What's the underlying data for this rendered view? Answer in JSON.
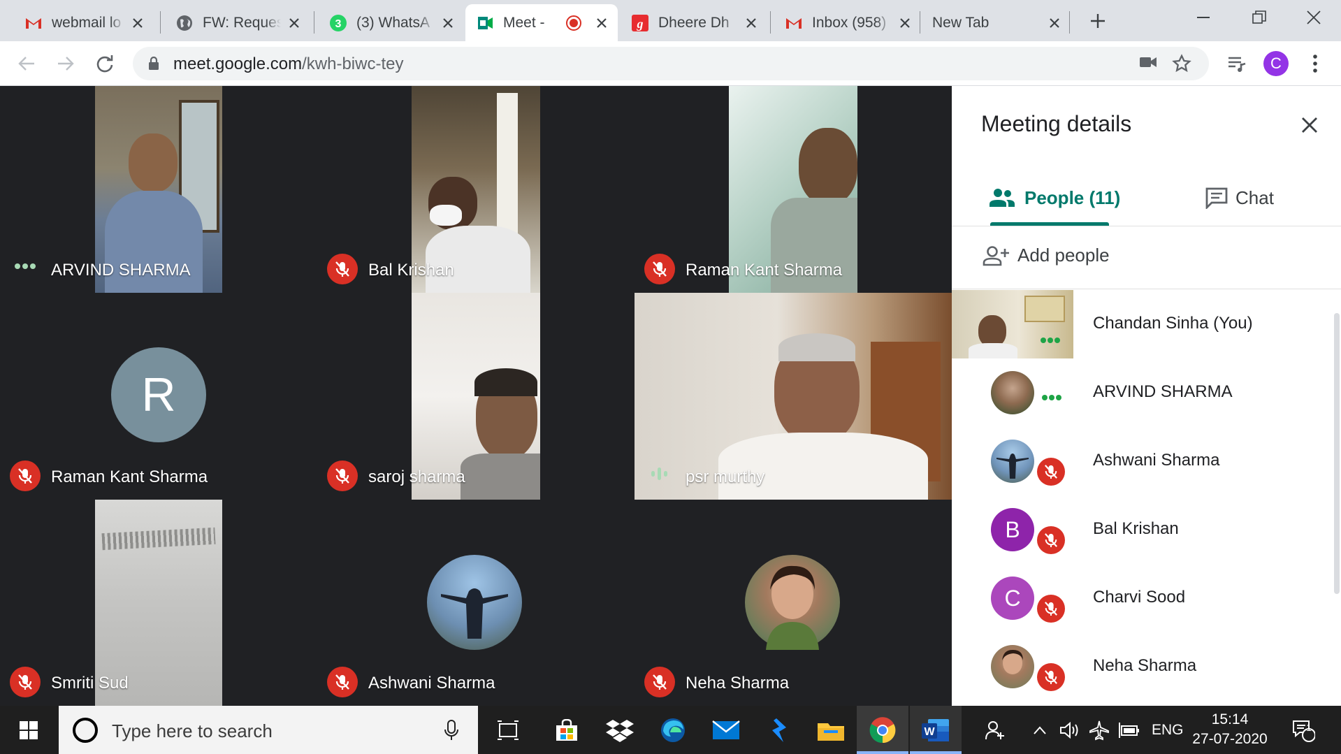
{
  "browser": {
    "tabs": [
      {
        "title": "webmail lo",
        "icon": "gmail-icon",
        "active": false
      },
      {
        "title": "FW: Reques",
        "icon": "globe-icon",
        "active": false
      },
      {
        "title": "(3) WhatsA",
        "icon": "whatsapp-icon",
        "active": false
      },
      {
        "title": "Meet -",
        "icon": "meet-icon",
        "active": true,
        "recording": true
      },
      {
        "title": "Dheere Dh",
        "icon": "gaana-icon",
        "active": false
      },
      {
        "title": "Inbox (958)",
        "icon": "gmail-icon",
        "active": false
      },
      {
        "title": "New Tab",
        "icon": "",
        "active": false
      }
    ],
    "url_host": "meet.google.com",
    "url_path": "/kwh-biwc-tey",
    "profile_letter": "C",
    "accent": "#9334e6"
  },
  "meet": {
    "tiles": [
      {
        "name": "ARVIND SHARMA",
        "status": "dots"
      },
      {
        "name": "Bal Krishan",
        "status": "muted"
      },
      {
        "name": "Raman Kant Sharma",
        "status": "muted"
      },
      {
        "name": "Raman Kant Sharma",
        "status": "muted",
        "avatar_letter": "R",
        "avatar_color": "#78909c"
      },
      {
        "name": "saroj sharma",
        "status": "muted"
      },
      {
        "name": "psr murthy",
        "status": "speaking"
      },
      {
        "name": "Smriti Sud",
        "status": "muted"
      },
      {
        "name": "Ashwani Sharma",
        "status": "muted"
      },
      {
        "name": "Neha Sharma",
        "status": "muted"
      }
    ],
    "panel": {
      "title": "Meeting details",
      "people_tab": "People (11)",
      "chat_tab": "Chat",
      "add_people": "Add people",
      "participants": [
        {
          "name": "Chandan Sinha (You)",
          "status": "dots"
        },
        {
          "name": "ARVIND SHARMA",
          "status": "dots"
        },
        {
          "name": "Ashwani Sharma",
          "status": "muted"
        },
        {
          "name": "Bal Krishan",
          "status": "muted",
          "avatar_letter": "B",
          "avatar_color": "#8e24aa"
        },
        {
          "name": "Charvi Sood",
          "status": "muted",
          "avatar_letter": "C",
          "avatar_color": "#ab47bc"
        },
        {
          "name": "Neha Sharma",
          "status": "muted"
        }
      ]
    }
  },
  "taskbar": {
    "search_placeholder": "Type here to search",
    "language": "ENG",
    "time": "15:14",
    "date": "27-07-2020",
    "notification_count": "1"
  }
}
